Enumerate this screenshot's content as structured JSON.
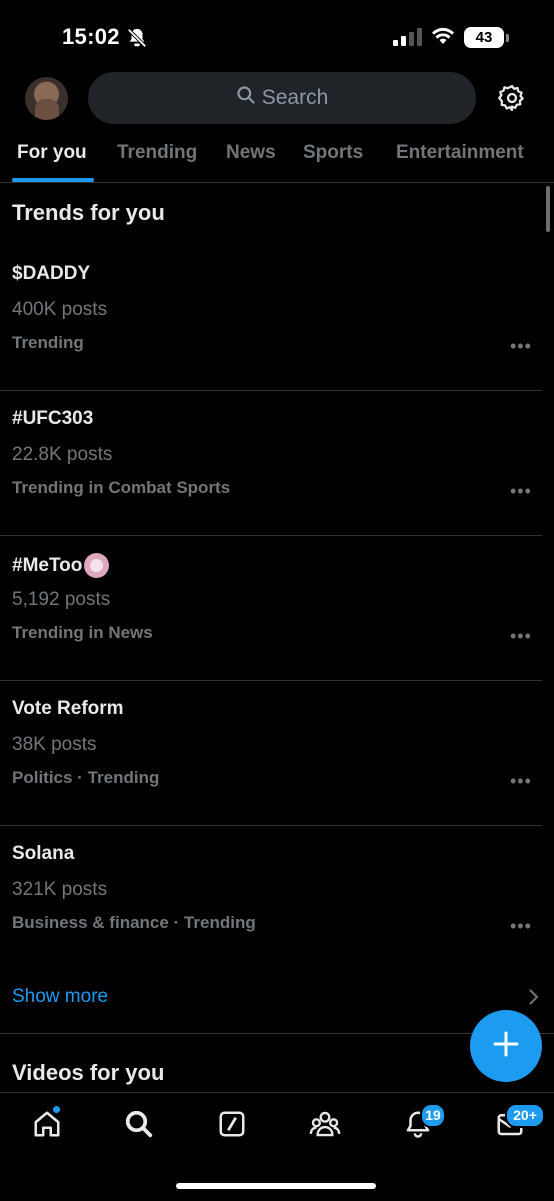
{
  "status_bar": {
    "time": "15:02",
    "battery": "43"
  },
  "header": {
    "search_placeholder": "Search"
  },
  "tabs": [
    {
      "label": "For you",
      "active": true
    },
    {
      "label": "Trending",
      "active": false
    },
    {
      "label": "News",
      "active": false
    },
    {
      "label": "Sports",
      "active": false
    },
    {
      "label": "Entertainment",
      "active": false
    }
  ],
  "trends_section": {
    "title": "Trends for you",
    "items": [
      {
        "name": "$DADDY",
        "count": "400K posts",
        "meta": "Trending"
      },
      {
        "name": "#UFC303",
        "count": "22.8K posts",
        "meta": "Trending in Combat Sports"
      },
      {
        "name": "#MeToo",
        "count": "5,192 posts",
        "meta": "Trending in News"
      },
      {
        "name": "Vote Reform",
        "count": "38K posts",
        "meta": "Politics · Trending"
      },
      {
        "name": "Solana",
        "count": "321K posts",
        "meta": "Business & finance · Trending"
      }
    ],
    "more_glyph": "•••",
    "show_more": "Show more"
  },
  "videos_section": {
    "title": "Videos for you"
  },
  "bottom_nav": {
    "notifications_badge": "19",
    "messages_badge": "20+"
  },
  "colors": {
    "accent": "#1d9bf0",
    "background": "#000000",
    "muted_text": "#71767b",
    "divider": "#2f3336"
  },
  "icons": [
    "bell-off-icon",
    "signal-icon",
    "wifi-icon",
    "search-icon",
    "gear-icon",
    "more-icon",
    "chevron-right-icon",
    "plus-icon",
    "home-icon",
    "grok-icon",
    "communities-icon",
    "notifications-icon",
    "messages-icon"
  ]
}
